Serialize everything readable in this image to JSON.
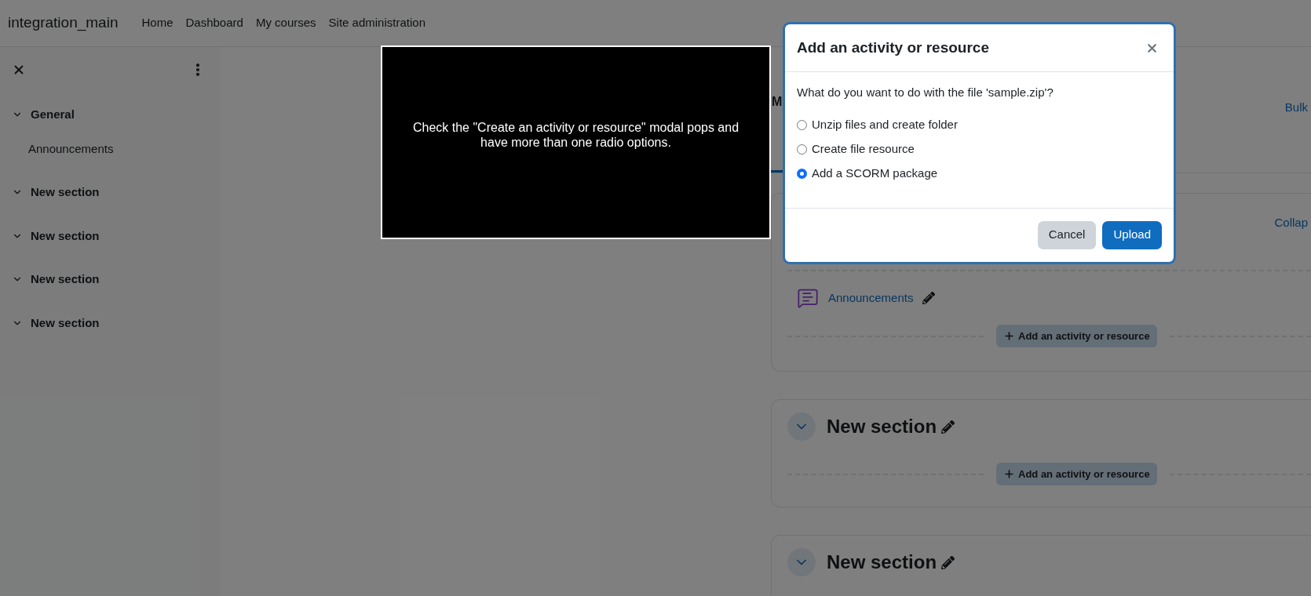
{
  "navbar": {
    "site_name": "integration_main",
    "links": [
      "Home",
      "Dashboard",
      "My courses",
      "Site administration"
    ]
  },
  "course_index": {
    "sections": [
      {
        "title": "General",
        "expanded": true,
        "children": [
          {
            "title": "Announcements"
          }
        ]
      },
      {
        "title": "New section",
        "expanded": true
      },
      {
        "title": "New section",
        "expanded": true
      },
      {
        "title": "New section",
        "expanded": true
      },
      {
        "title": "New section",
        "expanded": true
      }
    ]
  },
  "course": {
    "title": "M",
    "bulk_link": "Bulk",
    "sections": [
      {
        "kind": "general",
        "collapse_link": "Collap",
        "activities": [
          {
            "name": "Announcements"
          }
        ],
        "add_button": "Add an activity or resource"
      },
      {
        "kind": "section",
        "title": "New section",
        "expanded": true,
        "add_button": "Add an activity or resource"
      },
      {
        "kind": "section",
        "title": "New section",
        "expanded": true
      }
    ]
  },
  "overlay_note": {
    "text": "Check the \"Create an activity or resource\" modal pops and have more than one radio options."
  },
  "modal": {
    "title": "Add an activity or resource",
    "question": "What do you want to do with the file 'sample.zip'?",
    "options": [
      {
        "label": "Unzip files and create folder",
        "selected": false
      },
      {
        "label": "Create file resource",
        "selected": false
      },
      {
        "label": "Add a SCORM package",
        "selected": true
      }
    ],
    "buttons": [
      {
        "kind": "secondary",
        "label": "Cancel"
      },
      {
        "kind": "primary",
        "label": "Upload"
      }
    ]
  }
}
